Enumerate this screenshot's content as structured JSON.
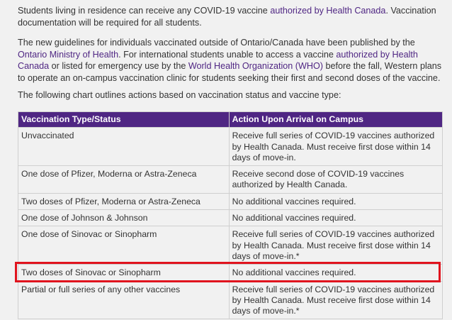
{
  "intro": {
    "p1_a": "Students living in residence can receive any COVID-19 vaccine ",
    "p1_link": "authorized by Health Canada",
    "p1_b": ". Vaccination documentation will be required for all students.",
    "p2_a": "The new guidelines for individuals vaccinated outside of Ontario/Canada have been published by the ",
    "p2_link1": "Ontario Ministry of Health",
    "p2_b": ". For international students unable to access a vaccine ",
    "p2_link2": "authorized by Health Canada",
    "p2_c": " or listed for emergency use by the ",
    "p2_link3": "World Health Organization (WHO)",
    "p2_d": " before the fall, Western plans to operate an on-campus vaccination clinic for students seeking their first and second doses of the vaccine.",
    "p3": "The following chart outlines actions based on vaccination status and vaccine type:"
  },
  "table": {
    "headers": [
      "Vaccination Type/Status",
      "Action Upon Arrival on Campus"
    ],
    "rows": [
      [
        "Unvaccinated",
        "Receive full series of COVID-19 vaccines authorized by Health Canada. Must receive first dose within 14 days of move-in."
      ],
      [
        "One dose of Pfizer, Moderna or Astra-Zeneca",
        "Receive second dose of COVID-19 vaccines authorized by Health Canada."
      ],
      [
        "Two doses of Pfizer, Moderna or Astra-Zeneca",
        "No additional vaccines required."
      ],
      [
        "One dose of Johnson & Johnson",
        "No additional vaccines required."
      ],
      [
        "One dose of Sinovac or Sinopharm",
        "Receive full series of COVID-19 vaccines authorized by Health Canada. Must receive first dose within 14 days of move-in.*"
      ],
      [
        "Two doses of Sinovac or Sinopharm",
        "No additional vaccines required."
      ],
      [
        "Partial or full series of any other vaccines",
        "Receive full series of COVID-19 vaccines authorized by Health Canada. Must receive first dose within 14 days of move-in.*"
      ]
    ]
  },
  "colors": {
    "header_bg": "#4f2683",
    "link": "#4f2683",
    "highlight": "#e0141e",
    "page_bg": "#f1f1f1"
  }
}
